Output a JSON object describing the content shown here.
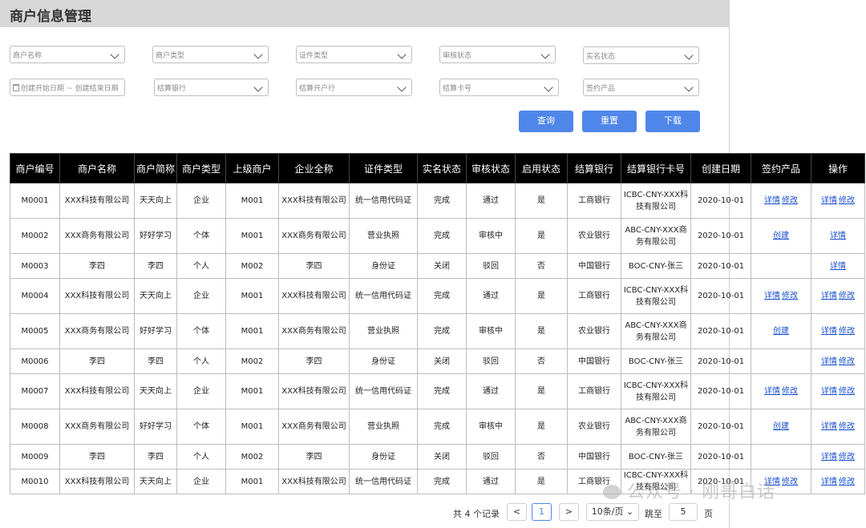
{
  "title": "商户信息管理",
  "filters": {
    "merchant_name": "商户名称",
    "merchant_type": "商户类型",
    "id_type": "证件类型",
    "review_status": "审核状态",
    "realname_status": "实名状态",
    "date_start": "创建开始日期",
    "date_end": "创建结束日期",
    "settle_bank": "结算银行",
    "settle_branch": "结算开户行",
    "settle_card": "结算卡号",
    "contract_product": "签约产品"
  },
  "buttons": {
    "query": "查询",
    "reset": "重置",
    "download": "下载"
  },
  "table": {
    "headers": [
      "商户编号",
      "商户名称",
      "商户简称",
      "商户类型",
      "上级商户",
      "企业全称",
      "证件类型",
      "实名状态",
      "审核状态",
      "启用状态",
      "结算银行",
      "结算银行卡号",
      "创建日期",
      "签约产品",
      "操作"
    ],
    "rows": [
      {
        "id": "M0001",
        "name": "XXX科技有限公司",
        "short": "天天向上",
        "type": "企业",
        "parent": "M001",
        "full": "XXX科技有限公司",
        "cert": "统一信用代码证",
        "realname": "完成",
        "review": "通过",
        "enabled": "是",
        "bank": "工商银行",
        "card": "ICBC-CNY-XXX科技有限公司",
        "date": "2020-10-01",
        "product": [
          "详情",
          "修改"
        ],
        "ops": [
          "详情",
          "修改"
        ]
      },
      {
        "id": "M0002",
        "name": "XXX商务有限公司",
        "short": "好好学习",
        "type": "个体",
        "parent": "M001",
        "full": "XXX商务有限公司",
        "cert": "营业执照",
        "realname": "完成",
        "review": "审核中",
        "enabled": "是",
        "bank": "农业银行",
        "card": "ABC-CNY-XXX商务有限公司",
        "date": "2020-10-01",
        "product": [
          "创建"
        ],
        "ops": [
          "详情"
        ]
      },
      {
        "id": "M0003",
        "name": "李四",
        "short": "李四",
        "type": "个人",
        "parent": "M002",
        "full": "李四",
        "cert": "身份证",
        "realname": "关闭",
        "review": "驳回",
        "enabled": "否",
        "bank": "中国银行",
        "card": "BOC-CNY-张三",
        "date": "2020-10-01",
        "product": [],
        "ops": [
          "详情"
        ]
      },
      {
        "id": "M0004",
        "name": "XXX科技有限公司",
        "short": "天天向上",
        "type": "企业",
        "parent": "M001",
        "full": "XXX科技有限公司",
        "cert": "统一信用代码证",
        "realname": "完成",
        "review": "通过",
        "enabled": "是",
        "bank": "工商银行",
        "card": "ICBC-CNY-XXX科技有限公司",
        "date": "2020-10-01",
        "product": [
          "详情",
          "修改"
        ],
        "ops": [
          "详情",
          "修改"
        ]
      },
      {
        "id": "M0005",
        "name": "XXX商务有限公司",
        "short": "好好学习",
        "type": "个体",
        "parent": "M001",
        "full": "XXX商务有限公司",
        "cert": "营业执照",
        "realname": "完成",
        "review": "审核中",
        "enabled": "是",
        "bank": "农业银行",
        "card": "ABC-CNY-XXX商务有限公司",
        "date": "2020-10-01",
        "product": [
          "创建"
        ],
        "ops": [
          "详情",
          "修改"
        ]
      },
      {
        "id": "M0006",
        "name": "李四",
        "short": "李四",
        "type": "个人",
        "parent": "M002",
        "full": "李四",
        "cert": "身份证",
        "realname": "关闭",
        "review": "驳回",
        "enabled": "否",
        "bank": "中国银行",
        "card": "BOC-CNY-张三",
        "date": "2020-10-01",
        "product": [],
        "ops": [
          "详情",
          "修改"
        ]
      },
      {
        "id": "M0007",
        "name": "XXX科技有限公司",
        "short": "天天向上",
        "type": "企业",
        "parent": "M001",
        "full": "XXX科技有限公司",
        "cert": "统一信用代码证",
        "realname": "完成",
        "review": "通过",
        "enabled": "是",
        "bank": "工商银行",
        "card": "ICBC-CNY-XXX科技有限公司",
        "date": "2020-10-01",
        "product": [
          "详情",
          "修改"
        ],
        "ops": [
          "详情",
          "修改"
        ]
      },
      {
        "id": "M0008",
        "name": "XXX商务有限公司",
        "short": "好好学习",
        "type": "个体",
        "parent": "M001",
        "full": "XXX商务有限公司",
        "cert": "营业执照",
        "realname": "完成",
        "review": "审核中",
        "enabled": "是",
        "bank": "农业银行",
        "card": "ABC-CNY-XXX商务有限公司",
        "date": "2020-10-01",
        "product": [
          "创建"
        ],
        "ops": [
          "详情",
          "修改"
        ]
      },
      {
        "id": "M0009",
        "name": "李四",
        "short": "李四",
        "type": "个人",
        "parent": "M002",
        "full": "李四",
        "cert": "身份证",
        "realname": "关闭",
        "review": "驳回",
        "enabled": "否",
        "bank": "中国银行",
        "card": "BOC-CNY-张三",
        "date": "2020-10-01",
        "product": [],
        "ops": [
          "详情",
          "修改"
        ]
      },
      {
        "id": "M0010",
        "name": "XXX科技有限公司",
        "short": "天天向上",
        "type": "企业",
        "parent": "M001",
        "full": "XXX科技有限公司",
        "cert": "统一信用代码证",
        "realname": "完成",
        "review": "通过",
        "enabled": "是",
        "bank": "工商银行",
        "card": "ICBC-CNY-XXX科技有限公司",
        "date": "2020-10-01",
        "product": [
          "详情",
          "修改"
        ],
        "ops": [
          "详情",
          "修改"
        ]
      }
    ]
  },
  "pagination": {
    "total_text": "共 4 个记录",
    "prev": "<",
    "current": "1",
    "next": ">",
    "page_size": "10条/页",
    "jump_label": "跳至",
    "jump_value": "5",
    "page_unit": "页"
  },
  "watermark": "公众号 · 刚哥白话"
}
